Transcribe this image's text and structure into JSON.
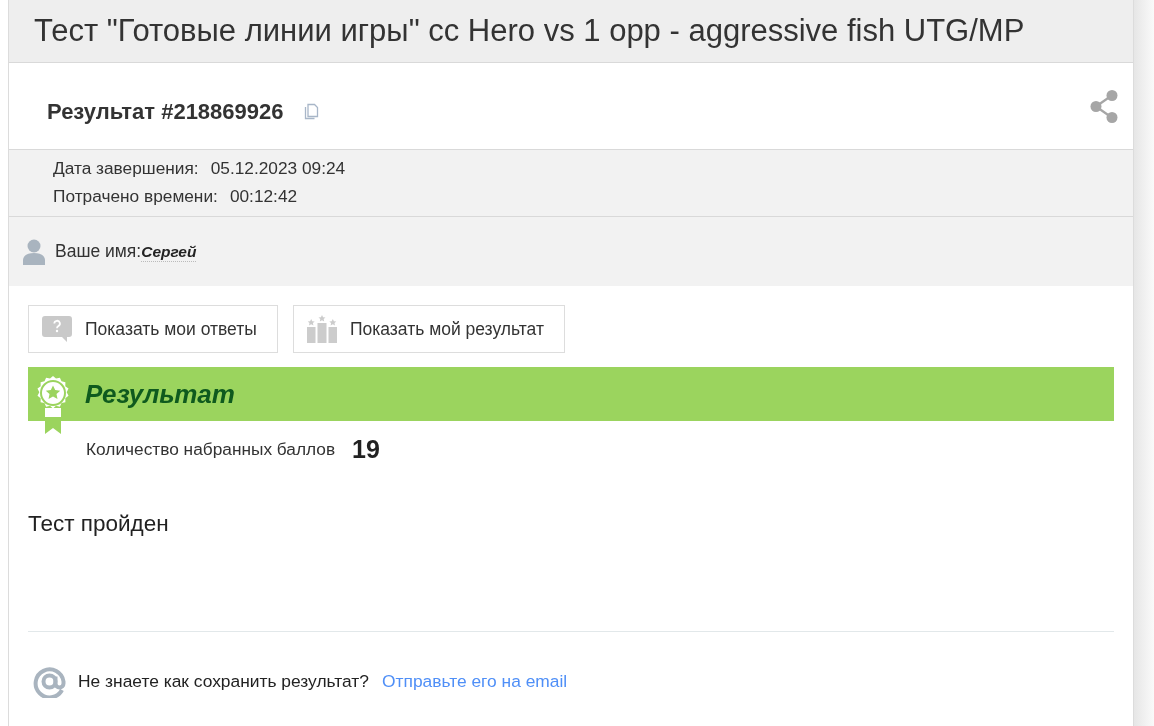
{
  "title": "Тест \"Готовые линии игры\" cc Hero vs 1 opp - aggressive fish UTG/MP",
  "result_header": {
    "label": "Результат #218869926"
  },
  "details": [
    {
      "label": "Дата завершения:",
      "value": "05.12.2023 09:24"
    },
    {
      "label": "Потрачено времени:",
      "value": "00:12:42"
    }
  ],
  "user": {
    "label": "Ваше имя:",
    "value": "Сергей"
  },
  "buttons": [
    {
      "kind": "answers",
      "label": "Показать мои ответы"
    },
    {
      "kind": "result",
      "label": "Показать мой результат"
    }
  ],
  "result": {
    "heading": "Результат",
    "score_label": "Количество набранных баллов",
    "score": "19",
    "verdict": "Тест пройден"
  },
  "footer": {
    "text": "Не знаете как сохранить результат?",
    "link": "Отправьте его на email"
  }
}
